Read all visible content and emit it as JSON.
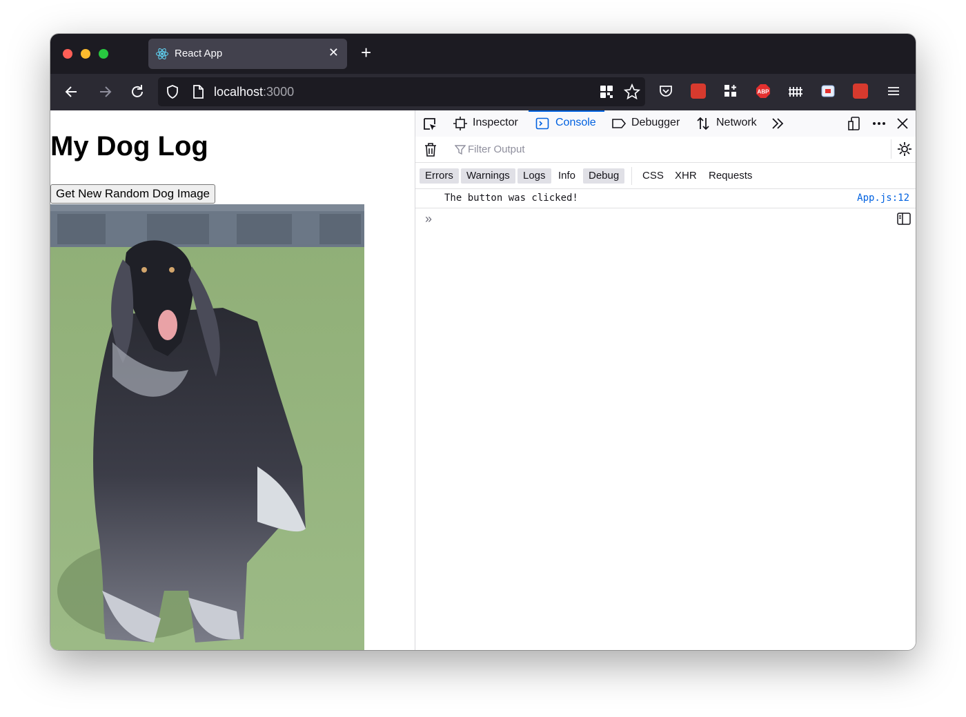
{
  "browser": {
    "tab": {
      "title": "React App",
      "favicon": "react-logo-icon",
      "close": "✕"
    },
    "new_tab": "+",
    "url": {
      "host": "localhost",
      "port": ":3000"
    }
  },
  "page": {
    "heading": "My Dog Log",
    "button_label": "Get New Random Dog Image",
    "image": {
      "subject": "afghan-hound-photo"
    }
  },
  "devtools": {
    "tabs": [
      {
        "label": "Inspector",
        "icon": "inspector-icon"
      },
      {
        "label": "Console",
        "icon": "console-icon",
        "active": true
      },
      {
        "label": "Debugger",
        "icon": "debugger-icon"
      },
      {
        "label": "Network",
        "icon": "network-icon"
      }
    ],
    "filter_placeholder": "Filter Output",
    "categories": [
      {
        "label": "Errors",
        "on": true
      },
      {
        "label": "Warnings",
        "on": true
      },
      {
        "label": "Logs",
        "on": true
      },
      {
        "label": "Info",
        "on": false
      },
      {
        "label": "Debug",
        "on": true
      },
      {
        "label": "CSS",
        "on": false
      },
      {
        "label": "XHR",
        "on": false
      },
      {
        "label": "Requests",
        "on": false
      }
    ],
    "log": [
      {
        "message": "The button was clicked!",
        "source": "App.js:12"
      }
    ],
    "prompt": "»"
  },
  "colors": {
    "accent": "#0061e0",
    "tabstrip": "#1c1b22",
    "navbar": "#2b2a33"
  }
}
